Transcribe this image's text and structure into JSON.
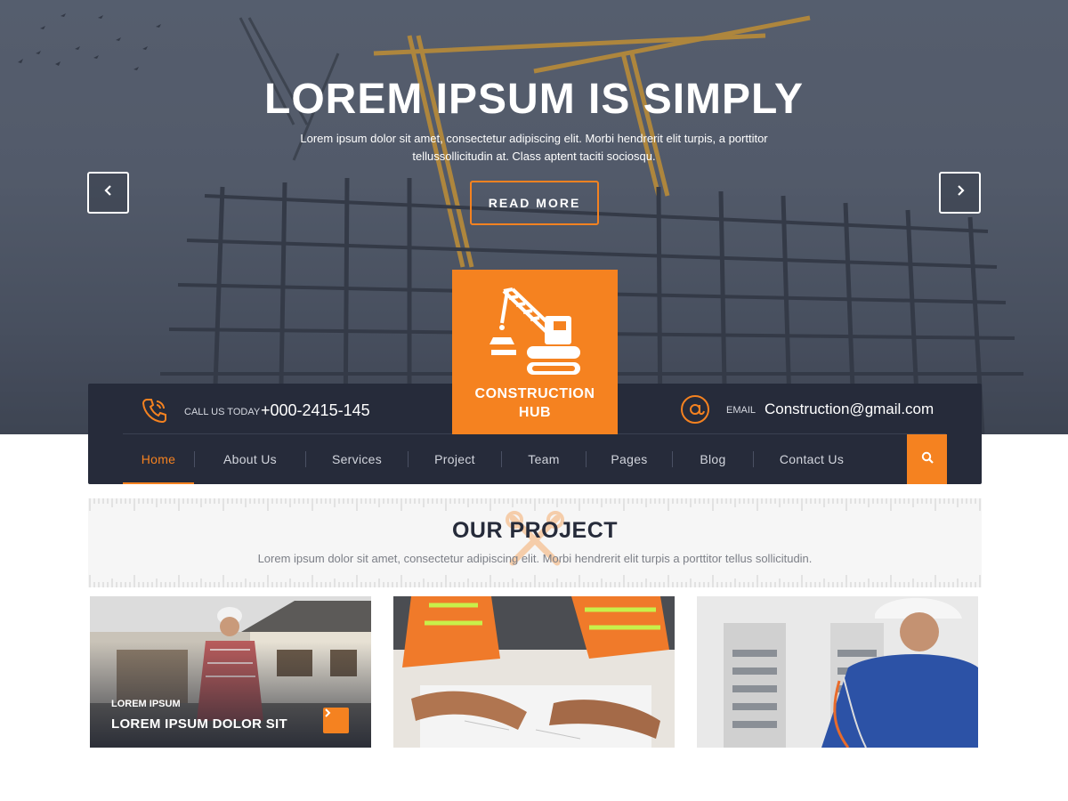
{
  "hero": {
    "title": "LOREM IPSUM IS SIMPLY",
    "subtitle": "Lorem ipsum dolor sit amet, consectetur adipiscing elit. Morbi hendrerit elit turpis, a porttitor tellussollicitudin at. Class aptent taciti sociosqu.",
    "button_label": "READ MORE",
    "prev_icon": "chevron-left-icon",
    "next_icon": "chevron-right-icon"
  },
  "logo": {
    "line1": "CONSTRUCTION",
    "line2": "HUB",
    "icon": "crane-icon"
  },
  "contact": {
    "call_label": "CALL US TODAY",
    "phone": "+000-2415-145",
    "email_label": "EMAIL",
    "email": "Construction@gmail.com"
  },
  "nav": {
    "items": [
      {
        "label": "Home",
        "active": true
      },
      {
        "label": "About Us"
      },
      {
        "label": "Services"
      },
      {
        "label": "Project"
      },
      {
        "label": "Team"
      },
      {
        "label": "Pages"
      },
      {
        "label": "Blog"
      },
      {
        "label": "Contact Us"
      }
    ],
    "search_icon": "search-icon"
  },
  "project_section": {
    "title": "OUR PROJECT",
    "subtitle": "Lorem ipsum dolor sit amet, consectetur adipiscing elit. Morbi hendrerit elit turpis a porttitor tellus sollicitudin."
  },
  "projects": [
    {
      "category": "LOREM IPSUM",
      "title": "LOREM IPSUM DOLOR SIT"
    },
    {},
    {}
  ],
  "colors": {
    "accent": "#f58220",
    "dark": "#262b3a"
  }
}
